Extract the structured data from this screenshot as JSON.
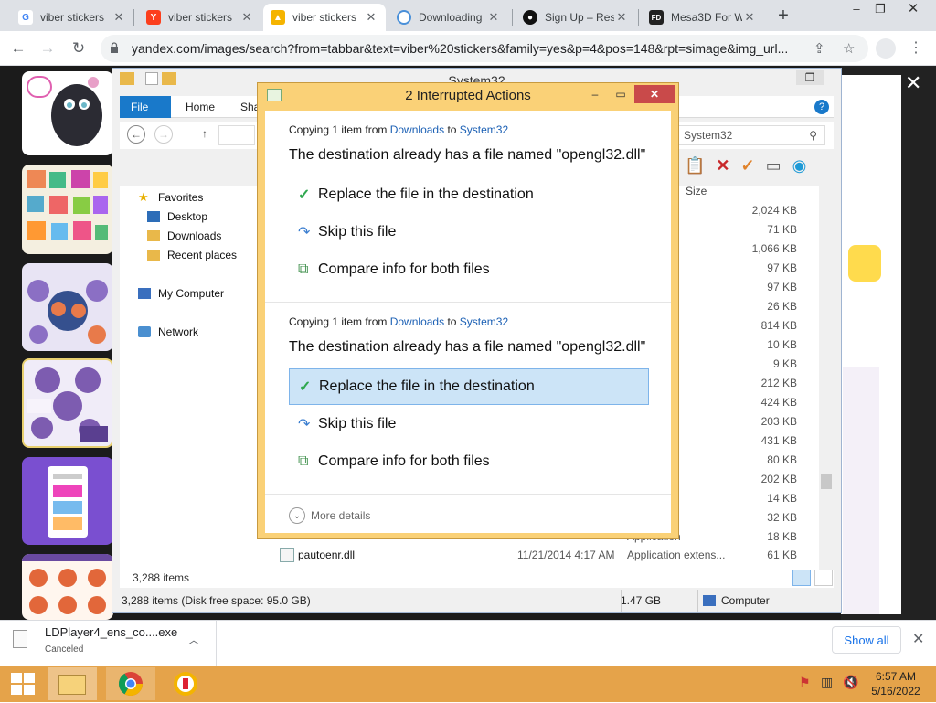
{
  "browser": {
    "tabs": [
      {
        "label": "viber stickers",
        "icon": "google-icon",
        "color": "#4285f4"
      },
      {
        "label": "viber stickers",
        "icon": "yandex-icon",
        "color": "#fc3f1d"
      },
      {
        "label": "viber stickers",
        "icon": "image-icon",
        "color": "#f5b400"
      },
      {
        "label": "Downloading",
        "icon": "loading-icon",
        "color": "#4a90d9"
      },
      {
        "label": "Sign Up – Res",
        "icon": "site-icon",
        "color": "#111111"
      },
      {
        "label": "Mesa3D For W",
        "icon": "fd-icon",
        "color": "#222222"
      }
    ],
    "url": "yandex.com/images/search?from=tabbar&text=viber%20stickers&family=yes&p=4&pos=148&rpt=simage&img_url..."
  },
  "explorer": {
    "title": "System32",
    "ribbon_tabs": [
      "File",
      "Home",
      "Shar"
    ],
    "search_placeholder": "System32",
    "column_size": "Size",
    "nav": {
      "favorites": "Favorites",
      "desktop": "Desktop",
      "downloads": "Downloads",
      "recent": "Recent places",
      "computer": "My Computer",
      "network": "Network"
    },
    "rows": [
      {
        "type": "n extens...",
        "size": "2,024 KB"
      },
      {
        "type": "n",
        "size": "71 KB"
      },
      {
        "type": "n extens...",
        "size": "1,066 KB"
      },
      {
        "type": "n",
        "size": "97 KB"
      },
      {
        "type": "n",
        "size": "97 KB"
      },
      {
        "type": "n extens...",
        "size": "26 KB"
      },
      {
        "type": "n",
        "size": "814 KB"
      },
      {
        "type": "n extens...",
        "size": "10 KB"
      },
      {
        "type": "n extens...",
        "size": "9 KB"
      },
      {
        "type": "n extens...",
        "size": "212 KB"
      },
      {
        "type": "n extens...",
        "size": "424 KB"
      },
      {
        "type": "n extens...",
        "size": "203 KB"
      },
      {
        "type": "n extens...",
        "size": "431 KB"
      },
      {
        "type": "n extens...",
        "size": "80 KB"
      },
      {
        "type": "n extens...",
        "size": "202 KB"
      },
      {
        "type": "n extens...",
        "size": "14 KB"
      },
      {
        "type": "n",
        "size": "32 KB"
      },
      {
        "type": "Application",
        "size": "18 KB"
      }
    ],
    "last_row": {
      "name": "pautoenr.dll",
      "date": "11/21/2014 4:17 AM",
      "type": "Application extens...",
      "size": "61 KB"
    },
    "item_count": "3,288 items",
    "status_left": "3,288 items (Disk free space: 95.0 GB)",
    "status_size": "1.47 GB",
    "status_loc": "Computer"
  },
  "dialog": {
    "title": "2 Interrupted Actions",
    "sections": [
      {
        "copy_prefix": "Copying 1 item from",
        "from": "Downloads",
        "to_word": "to",
        "to": "System32",
        "message": "The destination already has a file named \"opengl32.dll\"",
        "replace": "Replace the file in the destination",
        "skip": "Skip this file",
        "compare": "Compare info for both files"
      },
      {
        "copy_prefix": "Copying 1 item from",
        "from": "Downloads",
        "to_word": "to",
        "to": "System32",
        "message": "The destination already has a file named \"opengl32.dll\"",
        "replace": "Replace the file in the destination",
        "skip": "Skip this file",
        "compare": "Compare info for both files"
      }
    ],
    "more_details": "More details"
  },
  "download": {
    "filename": "LDPlayer4_ens_co....exe",
    "status": "Canceled",
    "show_all": "Show all"
  },
  "taskbar": {
    "time": "6:57 AM",
    "date": "5/16/2022"
  }
}
